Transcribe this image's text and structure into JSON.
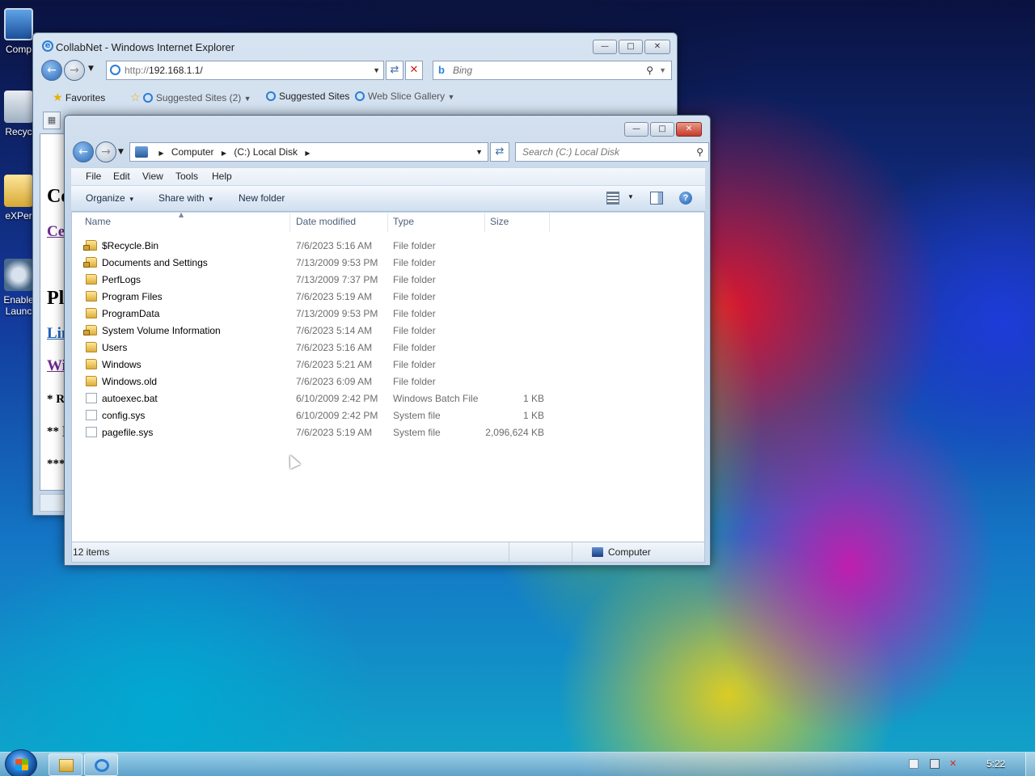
{
  "desktop": {
    "icons": [
      {
        "label": "Comp",
        "icon": "computer-icon"
      },
      {
        "label": "Recyc",
        "icon": "recycle-bin-icon"
      },
      {
        "label": "eXPer",
        "icon": "folder-icon"
      },
      {
        "label": "Enable",
        "label2": "Launc",
        "icon": "enable-icon"
      }
    ]
  },
  "ie": {
    "title": "CollabNet - Windows Internet Explorer",
    "address_protocol": "http://",
    "address_host": "192.168.1.1/",
    "search_placeholder": "Bing",
    "favorites_label": "Favorites",
    "fav_items": [
      "Suggested Sites (2)",
      "Suggested Sites",
      "Web Slice Gallery"
    ],
    "page_fragments": {
      "heading1": "Ce",
      "link1": "Ce",
      "heading2": "Pl",
      "link2": "Lin",
      "link3": "Wi",
      "text1": "* R",
      "text2": "** ]",
      "text3": "***"
    }
  },
  "explorer": {
    "breadcrumb": [
      "Computer",
      "(C:) Local Disk"
    ],
    "search_placeholder": "Search (C:) Local Disk",
    "menu": {
      "file": "File",
      "edit": "Edit",
      "view": "View",
      "tools": "Tools",
      "help": "Help"
    },
    "commands": {
      "organize": "Organize",
      "share_with": "Share with",
      "new_folder": "New folder"
    },
    "columns": {
      "name": "Name",
      "date": "Date modified",
      "type": "Type",
      "size": "Size"
    },
    "files": [
      {
        "name": "$Recycle.Bin",
        "date": "7/6/2023 5:16 AM",
        "type": "File folder",
        "size": "",
        "kind": "folder",
        "locked": true
      },
      {
        "name": "Documents and Settings",
        "date": "7/13/2009 9:53 PM",
        "type": "File folder",
        "size": "",
        "kind": "folder",
        "locked": true
      },
      {
        "name": "PerfLogs",
        "date": "7/13/2009 7:37 PM",
        "type": "File folder",
        "size": "",
        "kind": "folder",
        "locked": false
      },
      {
        "name": "Program Files",
        "date": "7/6/2023 5:19 AM",
        "type": "File folder",
        "size": "",
        "kind": "folder",
        "locked": false
      },
      {
        "name": "ProgramData",
        "date": "7/13/2009 9:53 PM",
        "type": "File folder",
        "size": "",
        "kind": "folder",
        "locked": false
      },
      {
        "name": "System Volume Information",
        "date": "7/6/2023 5:14 AM",
        "type": "File folder",
        "size": "",
        "kind": "folder",
        "locked": true
      },
      {
        "name": "Users",
        "date": "7/6/2023 5:16 AM",
        "type": "File folder",
        "size": "",
        "kind": "folder",
        "locked": false
      },
      {
        "name": "Windows",
        "date": "7/6/2023 5:21 AM",
        "type": "File folder",
        "size": "",
        "kind": "folder",
        "locked": false
      },
      {
        "name": "Windows.old",
        "date": "7/6/2023 6:09 AM",
        "type": "File folder",
        "size": "",
        "kind": "folder",
        "locked": false
      },
      {
        "name": "autoexec.bat",
        "date": "6/10/2009 2:42 PM",
        "type": "Windows Batch File",
        "size": "1 KB",
        "kind": "file",
        "locked": false
      },
      {
        "name": "config.sys",
        "date": "6/10/2009 2:42 PM",
        "type": "System file",
        "size": "1 KB",
        "kind": "file",
        "locked": false
      },
      {
        "name": "pagefile.sys",
        "date": "7/6/2023 5:19 AM",
        "type": "System file",
        "size": "2,096,624 KB",
        "kind": "file",
        "locked": false
      }
    ],
    "status_count": "12 items",
    "status_location": "Computer"
  },
  "taskbar": {
    "clock": "5:22"
  }
}
